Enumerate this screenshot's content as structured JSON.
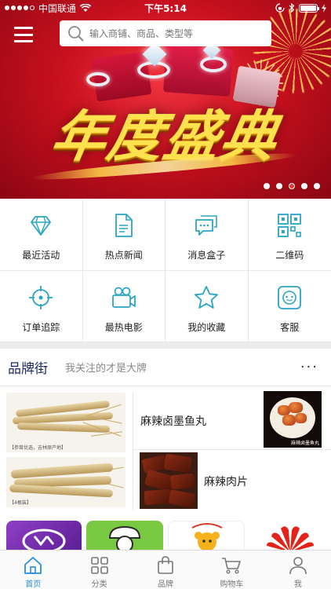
{
  "status_bar": {
    "carrier": "中国联通",
    "time": "下午5:14"
  },
  "header": {
    "search_placeholder": "输入商铺、商品、类型等"
  },
  "banner": {
    "title": "年度盛典",
    "slide_count": 5,
    "active_slide": 3
  },
  "quick_menu": [
    {
      "label": "最近活动",
      "icon": "diamond-icon"
    },
    {
      "label": "热点新闻",
      "icon": "document-icon"
    },
    {
      "label": "消息盒子",
      "icon": "message-icon"
    },
    {
      "label": "二维码",
      "icon": "qrcode-icon"
    },
    {
      "label": "订单追踪",
      "icon": "crosshair-icon"
    },
    {
      "label": "最热电影",
      "icon": "video-camera-icon"
    },
    {
      "label": "我的收藏",
      "icon": "star-icon"
    },
    {
      "label": "客服",
      "icon": "customer-service-icon"
    }
  ],
  "brand_street": {
    "title": "品牌街",
    "subtitle": "我关注的才是大牌",
    "more": "···",
    "items": [
      {
        "name": "麻辣卤墨鱼丸",
        "image_caption": "麻辣卤墨鱼丸"
      },
      {
        "name": "麻辣肉片"
      }
    ],
    "ginseng_captions": [
      "【参茸优选，吉林原产地】",
      "【4根装】"
    ]
  },
  "tab_bar": {
    "tabs": [
      {
        "label": "首页",
        "icon": "home-icon",
        "active": true
      },
      {
        "label": "分类",
        "icon": "category-grid-icon",
        "active": false
      },
      {
        "label": "品牌",
        "icon": "shopping-bag-icon",
        "active": false
      },
      {
        "label": "购物车",
        "icon": "cart-icon",
        "active": false
      },
      {
        "label": "我",
        "icon": "person-icon",
        "active": false
      }
    ]
  },
  "colors": {
    "accent": "#2a8fd6",
    "icon_teal": "#2aa5c4",
    "banner_red": "#c8101e",
    "brand_title": "#1f2c66"
  }
}
